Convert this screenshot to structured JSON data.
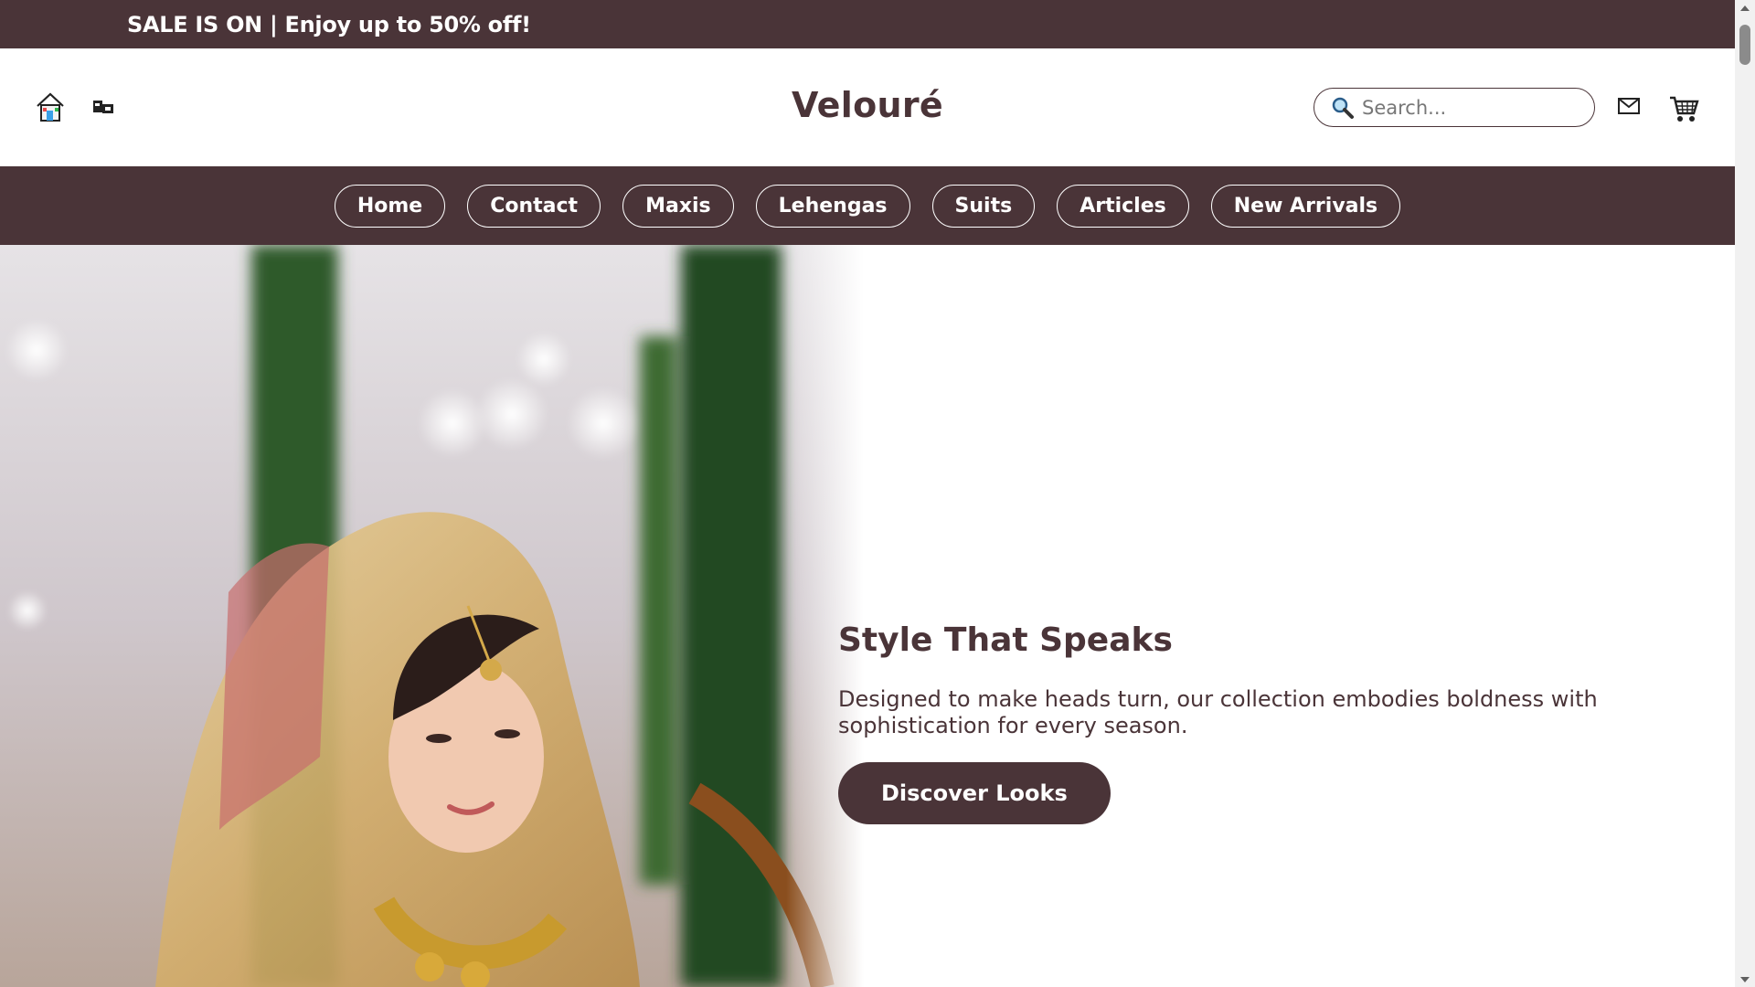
{
  "banner": {
    "text": "SALE IS ON | Enjoy up to 50% off!"
  },
  "header": {
    "brand": "Velouré",
    "search": {
      "placeholder": "Search...",
      "value": ""
    },
    "icons": [
      "home-icon",
      "shop-icon",
      "search-icon",
      "mail-icon",
      "cart-icon"
    ]
  },
  "nav": {
    "items": [
      {
        "label": "Home"
      },
      {
        "label": "Contact"
      },
      {
        "label": "Maxis"
      },
      {
        "label": "Lehengas"
      },
      {
        "label": "Suits"
      },
      {
        "label": "Articles"
      },
      {
        "label": "New Arrivals"
      }
    ]
  },
  "hero": {
    "title": "Style That Speaks",
    "text": "Designed to make heads turn, our collection embodies boldness with sophistication for every season.",
    "button_label": "Discover Looks"
  },
  "colors": {
    "brand": "#4a3438",
    "background": "#ffffff",
    "accent": "#c9a24b"
  }
}
